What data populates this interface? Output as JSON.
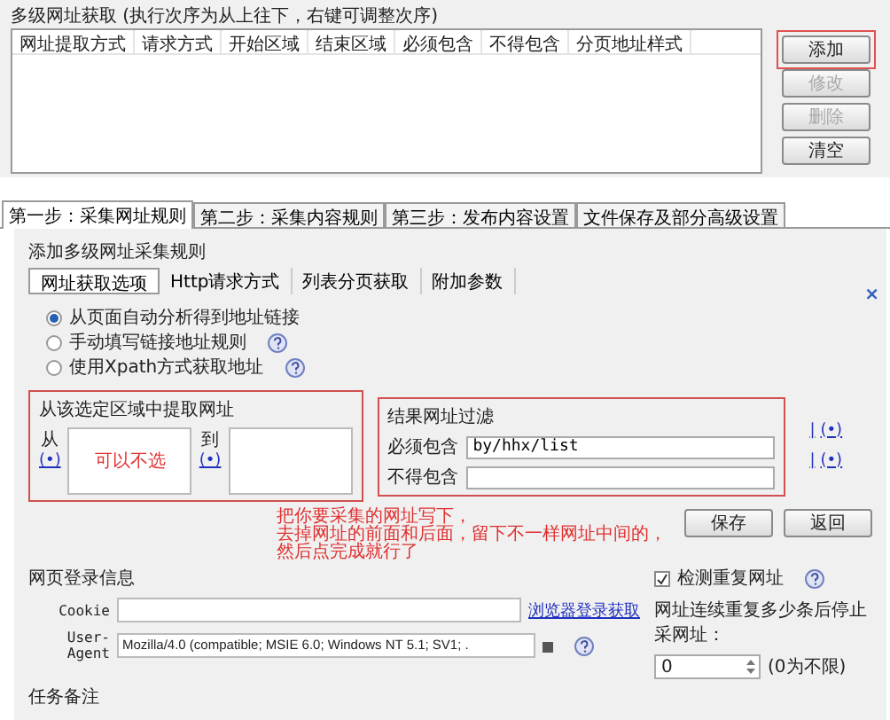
{
  "url_list": {
    "title": "多级网址获取 (执行次序为从上往下，右键可调整次序)",
    "columns": [
      "网址提取方式",
      "请求方式",
      "开始区域",
      "结束区域",
      "必须包含",
      "不得包含",
      "分页地址样式"
    ],
    "buttons": [
      {
        "label": "添加",
        "disabled": false,
        "highlighted": true
      },
      {
        "label": "修改",
        "disabled": true,
        "highlighted": false
      },
      {
        "label": "删除",
        "disabled": true,
        "highlighted": false
      },
      {
        "label": "清空",
        "disabled": false,
        "highlighted": false
      }
    ]
  },
  "tabs": [
    {
      "label": "第一步：采集网址规则",
      "selected": true
    },
    {
      "label": "第二步：采集内容规则",
      "selected": false
    },
    {
      "label": "第三步：发布内容设置",
      "selected": false
    },
    {
      "label": "文件保存及部分高级设置",
      "selected": false
    }
  ],
  "rule_panel": {
    "title": "添加多级网址采集规则",
    "close": "×",
    "subtabs": [
      {
        "label": "网址获取选项",
        "selected": true
      },
      {
        "label": "Http请求方式",
        "selected": false
      },
      {
        "label": "列表分页获取",
        "selected": false
      },
      {
        "label": "附加参数",
        "selected": false
      }
    ],
    "options": [
      {
        "label": "从页面自动分析得到地址链接",
        "selected": true,
        "help": false
      },
      {
        "label": "手动填写链接地址规则",
        "selected": false,
        "help": true
      },
      {
        "label": "使用Xpath方式获取地址",
        "selected": false,
        "help": true
      }
    ],
    "region": {
      "title": "从该选定区域中提取网址",
      "highlighted": true,
      "from_label": "从",
      "from_link": "(•)",
      "note": "可以不选",
      "to_label": "到",
      "to_link": "(•)"
    },
    "filter": {
      "title": "结果网址过滤",
      "highlighted": true,
      "rows": [
        {
          "label": "必须包含",
          "value": "by/hhx/list",
          "sep": "|",
          "link": "(•)"
        },
        {
          "label": "不得包含",
          "value": "",
          "sep": "|",
          "link": "(•)"
        }
      ]
    },
    "annotation": [
      "把你要采集的网址写下，",
      "去掉网址的前面和后面，留下不一样网址中间的，",
      "然后点完成就行了"
    ],
    "buttons": [
      "保存",
      "返回"
    ]
  },
  "login": {
    "title": "网页登录信息",
    "cookie_label": "Cookie",
    "cookie_link": "浏览器登录获取",
    "ua_label": "User-Agent",
    "ua_value": "Mozilla/4.0 (compatible; MSIE 6.0; Windows NT 5.1; SV1; ."
  },
  "duplicates": {
    "label": "检测重复网址",
    "checked": true,
    "stop_label": "网址连续重复多少条后停止采网址：",
    "stop_value": "0",
    "stop_hint": "(0为不限)"
  },
  "notes_title": "任务备注"
}
